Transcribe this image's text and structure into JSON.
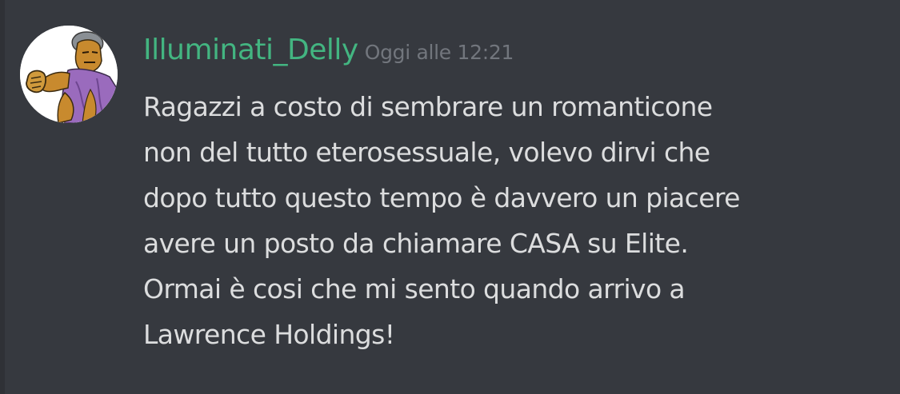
{
  "message": {
    "author": "Illuminati_Delly",
    "timestamp": "Oggi alle 12:21",
    "avatar": "avatar-icon",
    "lines": [
      "Ragazzi a costo di sembrare un romanticone",
      "non del tutto eterosessuale, volevo dirvi che",
      "dopo tutto questo tempo è davvero un piacere",
      "avere un posto da chiamare CASA su Elite.",
      "Ormai è cosi che mi sento quando arrivo a",
      "Lawrence Holdings!"
    ]
  },
  "colors": {
    "background": "#36393f",
    "username": "#43b581",
    "timestamp": "#72767d",
    "text": "#dcddde"
  }
}
